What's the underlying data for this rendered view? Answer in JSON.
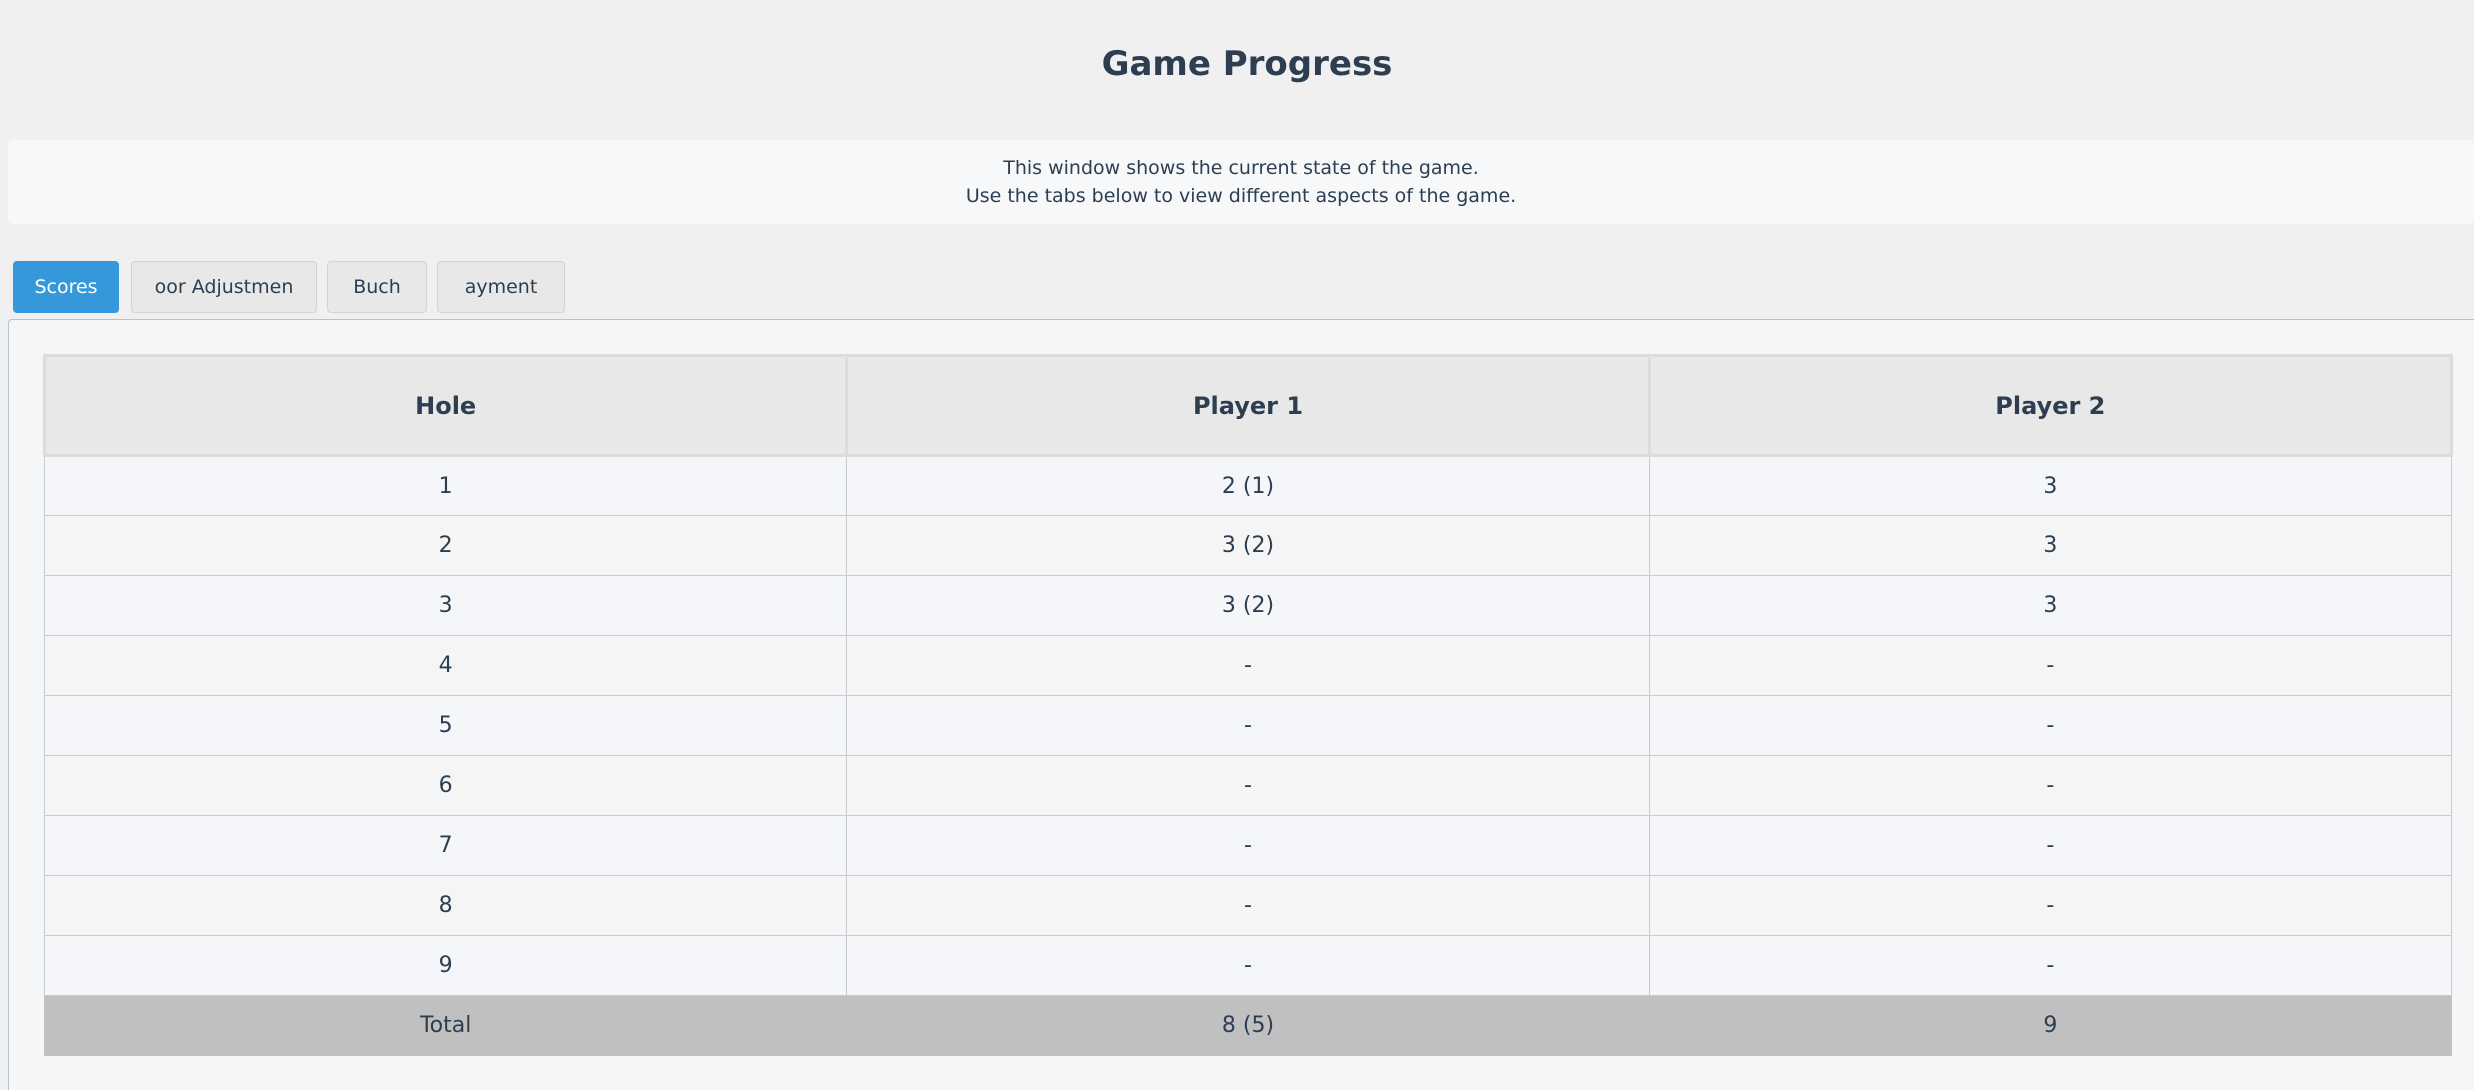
{
  "page": {
    "title": "Game Progress",
    "info_lines": [
      "This window shows the current state of the game.",
      "Use the tabs below to view different aspects of the game."
    ]
  },
  "tabs": [
    {
      "label": "Scores",
      "visible_text": "Scores",
      "active": true
    },
    {
      "label": "Poor Adjustment",
      "visible_text": "oor Adjustmen",
      "active": false
    },
    {
      "label": "Buch",
      "visible_text": "Buch",
      "active": false
    },
    {
      "label": "Payment",
      "visible_text": "ayment",
      "active": false
    }
  ],
  "colors": {
    "accent": "#3498db",
    "text": "#2c3e50",
    "total_row": "#c0c0c0"
  },
  "scores_table": {
    "headers": [
      "Hole",
      "Player 1",
      "Player 2"
    ],
    "rows": [
      [
        "1",
        "2 (1)",
        "3"
      ],
      [
        "2",
        "3 (2)",
        "3"
      ],
      [
        "3",
        "3 (2)",
        "3"
      ],
      [
        "4",
        "-",
        "-"
      ],
      [
        "5",
        "-",
        "-"
      ],
      [
        "6",
        "-",
        "-"
      ],
      [
        "7",
        "-",
        "-"
      ],
      [
        "8",
        "-",
        "-"
      ],
      [
        "9",
        "-",
        "-"
      ]
    ],
    "total": [
      "Total",
      "8 (5)",
      "9"
    ]
  }
}
